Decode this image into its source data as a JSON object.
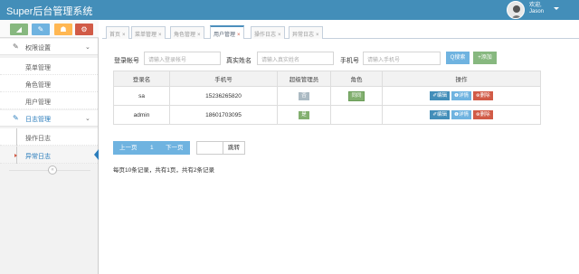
{
  "app": {
    "title": "Super后台管理系统"
  },
  "user": {
    "welcome": "欢迎,",
    "name": "Jason"
  },
  "shortcuts": [
    {
      "icon": "signal-icon",
      "glyph": "◢",
      "color": "#87b87f"
    },
    {
      "icon": "pencil-icon",
      "glyph": "✎",
      "color": "#6fb3e0"
    },
    {
      "icon": "users-icon",
      "glyph": "☗",
      "color": "#ffb752"
    },
    {
      "icon": "cogs-icon",
      "glyph": "⚙",
      "color": "#d15b47"
    }
  ],
  "sidebar": {
    "groups": [
      {
        "label": "权限设置",
        "icon": "edit-icon",
        "items": [
          "菜单管理",
          "角色管理",
          "用户管理"
        ]
      },
      {
        "label": "日志管理",
        "icon": "edit-icon",
        "items": [
          "操作日志",
          "异常日志"
        ]
      }
    ],
    "active_item": "异常日志",
    "chevron": "⌄",
    "collapse": "«"
  },
  "tabs": [
    {
      "label": "首页",
      "close": "×"
    },
    {
      "label": "菜单管理",
      "close": "×"
    },
    {
      "label": "角色管理",
      "close": "×"
    },
    {
      "label": "用户管理",
      "close": "×",
      "active": true
    },
    {
      "label": "操作日志",
      "close": "×"
    },
    {
      "label": "异常日志",
      "close": "×"
    }
  ],
  "search": {
    "login_label": "登录帐号",
    "login_placeholder": "请输入登录帐号",
    "name_label": "真实姓名",
    "name_placeholder": "请输入真实姓名",
    "phone_label": "手机号",
    "phone_placeholder": "请输入手机号",
    "search_button": "Q搜索",
    "add_button": "+添加"
  },
  "table": {
    "columns": [
      "登录名",
      "手机号",
      "超级管理员",
      "角色",
      "操作"
    ],
    "rows": [
      {
        "login": "sa",
        "phone": "15236265820",
        "super": "否",
        "super_color": "#abbac3",
        "role": "同同"
      },
      {
        "login": "admin",
        "phone": "18601703095",
        "super": "是",
        "super_color": "#82af6f",
        "role": ""
      }
    ],
    "actions": {
      "edit": "✐编辑",
      "detail": "❶详情",
      "delete": "⊗删除"
    }
  },
  "pagination": {
    "prev": "上一页",
    "page": "1",
    "next": "下一页",
    "jump": "跳转",
    "summary": "每页10条记录，共有1页，共有2条记录"
  }
}
